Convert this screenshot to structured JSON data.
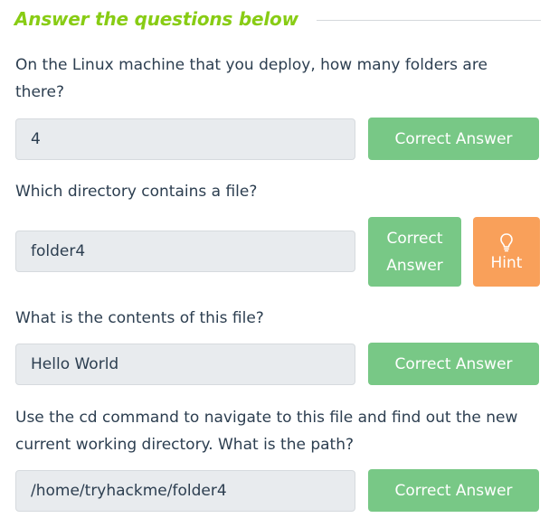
{
  "section": {
    "title": "Answer the questions below"
  },
  "questions": [
    {
      "text": "On the Linux machine that you deploy, how many folders are there?",
      "answer": "4",
      "button_label": "Correct Answer"
    },
    {
      "text": "Which directory contains a file?",
      "answer": "folder4",
      "button_label_line1": "Correct",
      "button_label_line2": "Answer",
      "hint_label": "Hint",
      "hint_icon": "lightbulb-icon"
    },
    {
      "text": "What is the contents of this file?",
      "answer": "Hello World",
      "button_label": "Correct Answer"
    },
    {
      "text": "Use the cd command to navigate to this file and find out the new current working directory. What is the path?",
      "answer": "/home/tryhackme/folder4",
      "button_label": "Correct Answer"
    }
  ],
  "colors": {
    "accent_green": "#88cc14",
    "correct_button": "#78c886",
    "hint_button": "#f9a05a",
    "input_bg": "#e8ebee",
    "text": "#2c3e50"
  }
}
